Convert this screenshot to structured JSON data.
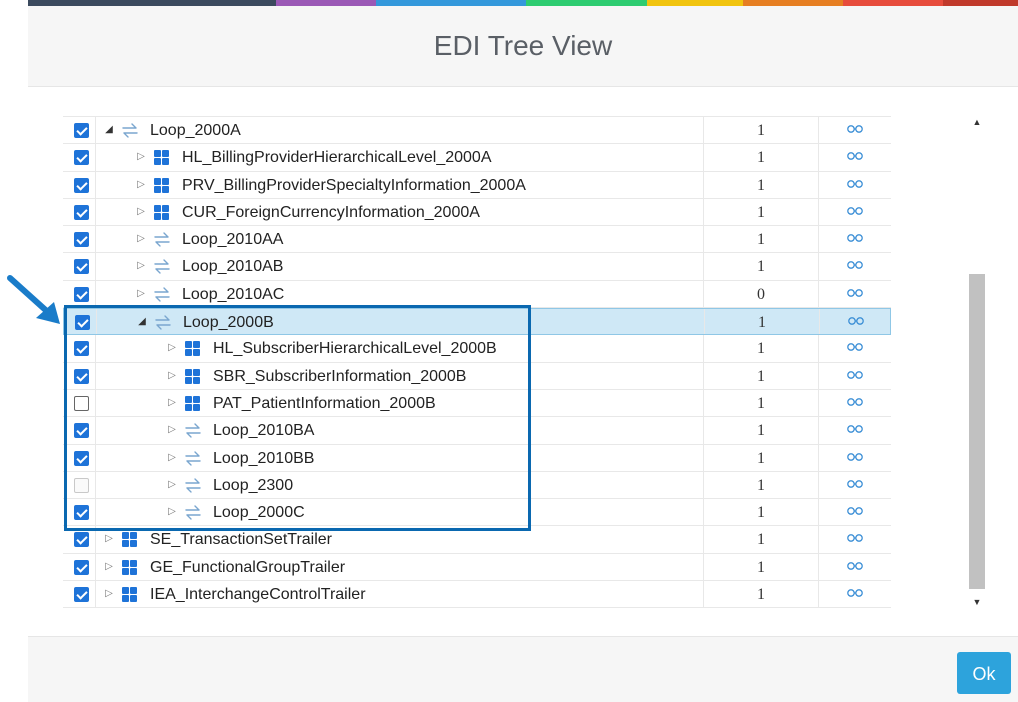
{
  "window": {
    "title": "EDI Tree View"
  },
  "accent_colors": [
    "#3b4a5e",
    "#9b59b6",
    "#3498db",
    "#2ecc71",
    "#f1c40f",
    "#e67e22",
    "#e74c3c",
    "#c0392b"
  ],
  "icons": {
    "segment": "grid-icon",
    "loop": "loop-icon",
    "view": "view-icon"
  },
  "tree": {
    "rows": [
      {
        "label": "Loop_2000A",
        "count": "1",
        "checked": "on",
        "kind": "loop",
        "level": 1,
        "open": true
      },
      {
        "label": "HL_BillingProviderHierarchicalLevel_2000A",
        "count": "1",
        "checked": "on",
        "kind": "segment",
        "level": 2,
        "open": false
      },
      {
        "label": "PRV_BillingProviderSpecialtyInformation_2000A",
        "count": "1",
        "checked": "on",
        "kind": "segment",
        "level": 2,
        "open": false
      },
      {
        "label": "CUR_ForeignCurrencyInformation_2000A",
        "count": "1",
        "checked": "on",
        "kind": "segment",
        "level": 2,
        "open": false
      },
      {
        "label": "Loop_2010AA",
        "count": "1",
        "checked": "on",
        "kind": "loop",
        "level": 2,
        "open": false
      },
      {
        "label": "Loop_2010AB",
        "count": "1",
        "checked": "on",
        "kind": "loop",
        "level": 2,
        "open": false
      },
      {
        "label": "Loop_2010AC",
        "count": "0",
        "checked": "on",
        "kind": "loop",
        "level": 2,
        "open": false
      },
      {
        "label": "Loop_2000B",
        "count": "1",
        "checked": "on",
        "kind": "loop",
        "level": 2,
        "open": true,
        "selected": true
      },
      {
        "label": "HL_SubscriberHierarchicalLevel_2000B",
        "count": "1",
        "checked": "on",
        "kind": "segment",
        "level": 3,
        "open": false
      },
      {
        "label": "SBR_SubscriberInformation_2000B",
        "count": "1",
        "checked": "on",
        "kind": "segment",
        "level": 3,
        "open": false
      },
      {
        "label": "PAT_PatientInformation_2000B",
        "count": "1",
        "checked": "off",
        "kind": "segment",
        "level": 3,
        "open": false
      },
      {
        "label": "Loop_2010BA",
        "count": "1",
        "checked": "on",
        "kind": "loop",
        "level": 3,
        "open": false
      },
      {
        "label": "Loop_2010BB",
        "count": "1",
        "checked": "on",
        "kind": "loop",
        "level": 3,
        "open": false
      },
      {
        "label": "Loop_2300",
        "count": "1",
        "checked": "disabled",
        "kind": "loop",
        "level": 3,
        "open": false
      },
      {
        "label": "Loop_2000C",
        "count": "1",
        "checked": "on",
        "kind": "loop",
        "level": 3,
        "open": false
      },
      {
        "label": "SE_TransactionSetTrailer",
        "count": "1",
        "checked": "on",
        "kind": "segment",
        "level": 1,
        "open": false
      },
      {
        "label": "GE_FunctionalGroupTrailer",
        "count": "1",
        "checked": "on",
        "kind": "segment",
        "level": 1,
        "open": false
      },
      {
        "label": "IEA_InterchangeControlTrailer",
        "count": "1",
        "checked": "on",
        "kind": "segment",
        "level": 1,
        "open": false
      }
    ]
  },
  "footer": {
    "ok_label": "Ok"
  }
}
